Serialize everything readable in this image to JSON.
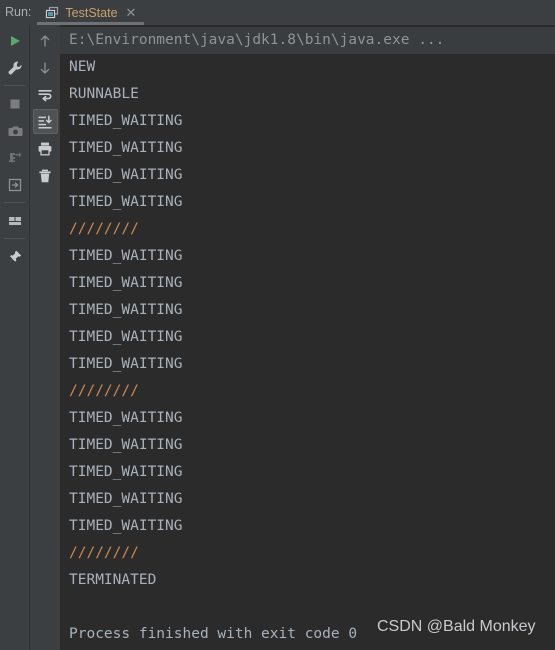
{
  "window": {
    "run_label": "Run:",
    "background_color": "#2b2b2b",
    "toolbar_color": "#3c3f41"
  },
  "tab": {
    "title": "TestState",
    "icon": "run-configuration-icon",
    "close_icon": "close-icon",
    "title_color": "#c8a06a",
    "active": true
  },
  "toolbar_left": {
    "buttons": [
      {
        "name": "rerun-button",
        "icon": "play-icon",
        "label": "Rerun",
        "color": "#59a869"
      },
      {
        "name": "edit-configuration-button",
        "icon": "wrench-icon",
        "label": "Edit Configuration",
        "color": "#afb1b3"
      },
      {
        "name": "stop-button",
        "icon": "stop-square-icon",
        "label": "Stop",
        "color": "#7a7c7e"
      },
      {
        "name": "camera-button",
        "icon": "camera-icon",
        "label": "Capture Snapshot",
        "color": "#7a7c7e"
      },
      {
        "name": "dump-threads-button",
        "icon": "dump-threads-icon",
        "label": "Dump Threads",
        "color": "#6e7072"
      },
      {
        "name": "restore-layout-button",
        "icon": "import-arrow-icon",
        "label": "Restore Layout",
        "color": "#8d9094"
      },
      {
        "name": "layout-settings-button",
        "icon": "layout-icon",
        "label": "Layout Settings",
        "color": "#afb1b3"
      },
      {
        "name": "pin-tab-button",
        "icon": "pin-icon",
        "label": "Pin Tab",
        "color": "#c9ccce"
      }
    ]
  },
  "toolbar_right": {
    "buttons": [
      {
        "name": "up-the-stack-trace-button",
        "icon": "arrow-up-icon",
        "label": "Up the Stack Trace",
        "color": "#8d9094"
      },
      {
        "name": "down-the-stack-trace-button",
        "icon": "arrow-down-icon",
        "label": "Down the Stack Trace",
        "color": "#8d9094"
      },
      {
        "name": "soft-wrap-button",
        "icon": "soft-wrap-icon",
        "label": "Use Soft Wraps",
        "color": "#c9ccce"
      },
      {
        "name": "scroll-to-end-button",
        "icon": "scroll-to-end-icon",
        "label": "Scroll to the End",
        "color": "#c9ccce",
        "selected": true
      },
      {
        "name": "print-button",
        "icon": "printer-icon",
        "label": "Print",
        "color": "#c9ccce"
      },
      {
        "name": "clear-all-button",
        "icon": "trash-icon",
        "label": "Clear All",
        "color": "#c9ccce"
      }
    ]
  },
  "console": {
    "command_line": "E:\\Environment\\java\\jdk1.8\\bin\\java.exe ...",
    "lines": [
      {
        "text": "NEW",
        "kind": "state"
      },
      {
        "text": "RUNNABLE",
        "kind": "state"
      },
      {
        "text": "TIMED_WAITING",
        "kind": "state"
      },
      {
        "text": "TIMED_WAITING",
        "kind": "state"
      },
      {
        "text": "TIMED_WAITING",
        "kind": "state"
      },
      {
        "text": "TIMED_WAITING",
        "kind": "state"
      },
      {
        "text": "////////",
        "kind": "separator"
      },
      {
        "text": "TIMED_WAITING",
        "kind": "state"
      },
      {
        "text": "TIMED_WAITING",
        "kind": "state"
      },
      {
        "text": "TIMED_WAITING",
        "kind": "state"
      },
      {
        "text": "TIMED_WAITING",
        "kind": "state"
      },
      {
        "text": "TIMED_WAITING",
        "kind": "state"
      },
      {
        "text": "////////",
        "kind": "separator"
      },
      {
        "text": "TIMED_WAITING",
        "kind": "state"
      },
      {
        "text": "TIMED_WAITING",
        "kind": "state"
      },
      {
        "text": "TIMED_WAITING",
        "kind": "state"
      },
      {
        "text": "TIMED_WAITING",
        "kind": "state"
      },
      {
        "text": "TIMED_WAITING",
        "kind": "state"
      },
      {
        "text": "////////",
        "kind": "separator"
      },
      {
        "text": "TERMINATED",
        "kind": "state"
      },
      {
        "text": "",
        "kind": "blank"
      },
      {
        "text": "Process finished with exit code 0",
        "kind": "exit"
      }
    ],
    "text_color": "#a9b2bb",
    "separator_color": "#cc8a52",
    "command_color": "#8f9297"
  },
  "watermark": {
    "text": "CSDN @Bald Monkey"
  }
}
